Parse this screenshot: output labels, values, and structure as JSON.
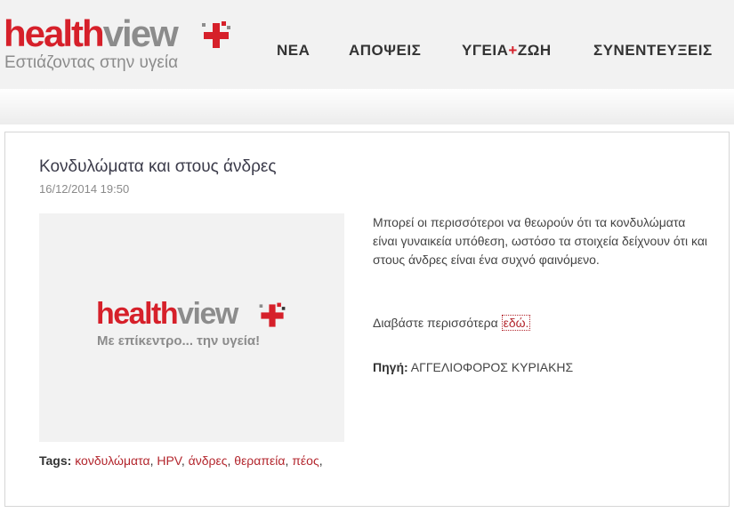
{
  "header": {
    "logo": {
      "part1": "health",
      "part2": "view",
      "tagline": "Εστιάζοντας στην υγεία"
    },
    "nav": [
      {
        "label": "ΝΕΑ"
      },
      {
        "label": "ΑΠΟΨΕΙΣ"
      },
      {
        "label_a": "ΥΓΕΙΑ",
        "plus": "+",
        "label_b": "ΖΩΗ"
      },
      {
        "label": "ΣΥΝΕΝΤΕΥΞΕΙΣ"
      }
    ]
  },
  "article": {
    "title": "Κονδυλώματα και στους άνδρες",
    "date": "16/12/2014 19:50",
    "image": {
      "part1": "health",
      "part2": "view",
      "tagline": "Με επίκεντρο... την υγεία!"
    },
    "body": "Μπορεί οι περισσότεροι να θεωρούν ότι τα κονδυλώματα είναι γυναικεία υπόθεση, ωστόσο τα στοιχεία δείχνουν ότι και στους άνδρες είναι ένα συχνό φαινόμενο.",
    "read_more_prefix": "Διαβάστε περισσότερα ",
    "read_more_link": "εδώ.",
    "source_label": "Πηγή:",
    "source_value": " ΑΓΓΕΛΙΟΦΟΡΟΣ ΚΥΡΙΑΚΗΣ",
    "tags_label": "Tags:",
    "tags": [
      "κονδυλώματα",
      "HPV",
      "άνδρες",
      "θεραπεία",
      "πέος"
    ]
  },
  "colors": {
    "brand_red": "#d6202a",
    "brand_gray": "#8c8c8c",
    "link": "#b3262d"
  }
}
